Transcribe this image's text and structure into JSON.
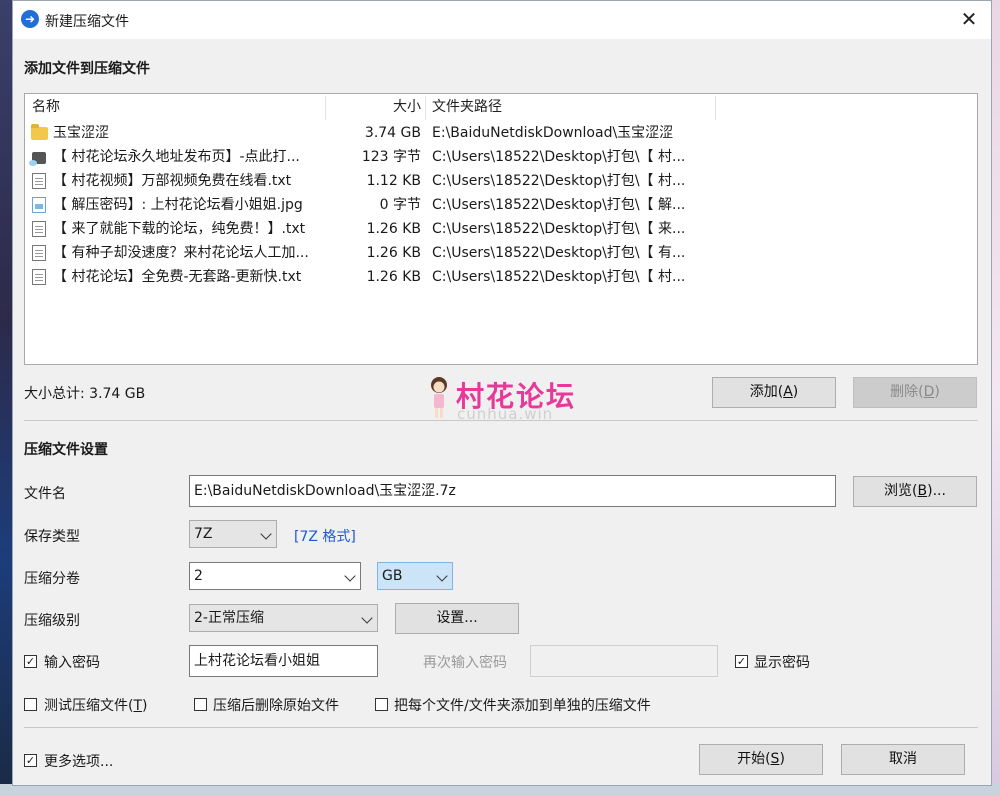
{
  "window": {
    "title": "新建压缩文件",
    "close_glyph": "✕",
    "app_icon": "7zip-app-icon"
  },
  "add_section": {
    "title": "添加文件到压缩文件",
    "columns": {
      "name": "名称",
      "size": "大小",
      "path": "文件夹路径"
    },
    "rows": [
      {
        "icon": "folder-icon",
        "name": "玉宝涩涩",
        "size": "3.74 GB",
        "path": "E:\\BaiduNetdiskDownload\\玉宝涩涩"
      },
      {
        "icon": "url-shortcut-icon",
        "name": "【 村花论坛永久地址发布页】-点此打...",
        "size": "123 字节",
        "path": "C:\\Users\\18522\\Desktop\\打包\\【 村..."
      },
      {
        "icon": "text-file-icon",
        "name": "【 村花视频】万部视频免费在线看.txt",
        "size": "1.12 KB",
        "path": "C:\\Users\\18522\\Desktop\\打包\\【 村..."
      },
      {
        "icon": "image-file-icon",
        "name": "【 解压密码】: 上村花论坛看小姐姐.jpg",
        "size": "0 字节",
        "path": "C:\\Users\\18522\\Desktop\\打包\\【 解..."
      },
      {
        "icon": "text-file-icon",
        "name": "【 来了就能下载的论坛，纯免费！】.txt",
        "size": "1.26 KB",
        "path": "C:\\Users\\18522\\Desktop\\打包\\【 来..."
      },
      {
        "icon": "text-file-icon",
        "name": "【 有种子却没速度？来村花论坛人工加...",
        "size": "1.26 KB",
        "path": "C:\\Users\\18522\\Desktop\\打包\\【 有..."
      },
      {
        "icon": "text-file-icon",
        "name": "【 村花论坛】全免费-无套路-更新快.txt",
        "size": "1.26 KB",
        "path": "C:\\Users\\18522\\Desktop\\打包\\【 村..."
      }
    ],
    "total_size": "大小总计: 3.74 GB",
    "add_button": "添加(A)",
    "add_button_main": "添加(",
    "add_button_key": "A",
    "delete_button_main": "删除(",
    "delete_button_key": "D"
  },
  "watermark": {
    "title": "村花论坛",
    "subtitle": "cunhua.win"
  },
  "settings": {
    "title": "压缩文件设置",
    "filename_label": "文件名",
    "filename_value": "E:\\BaiduNetdiskDownload\\玉宝涩涩.7z",
    "browse_main": "浏览(",
    "browse_key": "B",
    "browse_tail": ")...",
    "save_type_label": "保存类型",
    "save_type_value": "7Z",
    "format_link": "[7Z 格式]",
    "split_label": "压缩分卷",
    "split_value": "2",
    "split_unit": "GB",
    "level_label": "压缩级别",
    "level_value": "2-正常压缩",
    "level_settings_button": "设置...",
    "password_label": "输入密码",
    "password_checked": true,
    "password_value": "上村花论坛看小姐姐",
    "reenter_label": "再次输入密码",
    "show_password_label": "显示密码",
    "show_password_checked": true,
    "test_label_main": "测试压缩文件(",
    "test_label_key": "T",
    "delete_after_label": "压缩后删除原始文件",
    "each_file_label": "把每个文件/文件夹添加到单独的压缩文件",
    "more_options_label": "更多选项..."
  },
  "footer": {
    "start_main": "开始(",
    "start_key": "S",
    "cancel_button": "取消"
  },
  "colors": {
    "accent": "#1f57d6",
    "watermark": "#e8399a"
  }
}
